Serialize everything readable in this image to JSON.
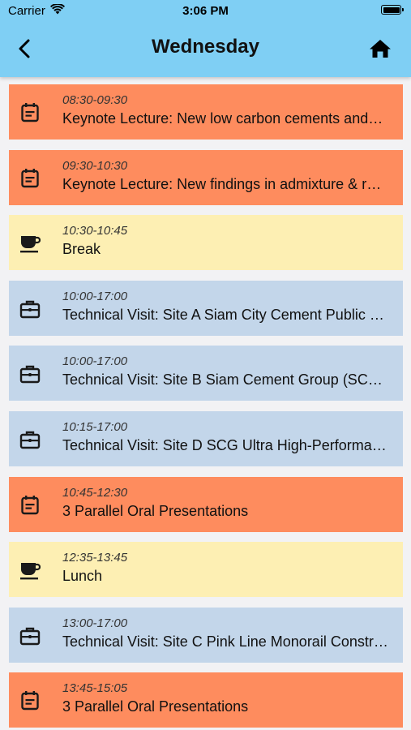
{
  "status_bar": {
    "carrier": "Carrier",
    "time": "3:06 PM",
    "wifi_icon": "wifi-icon",
    "battery_icon": "battery-icon"
  },
  "nav": {
    "title": "Wednesday",
    "back_icon": "chevron-left-icon",
    "home_icon": "home-icon",
    "color": "#7fcff4"
  },
  "colors": {
    "lecture": "#fe8c5e",
    "break": "#fdefb3",
    "visit": "#c3d6ea"
  },
  "schedule": [
    {
      "type": "lecture",
      "icon": "calendar-icon",
      "time": "08:30-09:30",
      "title": "Keynote Lecture: New low carbon cements and…"
    },
    {
      "type": "lecture",
      "icon": "calendar-icon",
      "time": "09:30-10:30",
      "title": "Keynote Lecture: New findings in admixture & r…"
    },
    {
      "type": "break",
      "icon": "coffee-icon",
      "time": "10:30-10:45",
      "title": "Break"
    },
    {
      "type": "visit",
      "icon": "briefcase-icon",
      "time": "10:00-17:00",
      "title": "Technical Visit: Site A Siam City Cement Public …"
    },
    {
      "type": "visit",
      "icon": "briefcase-icon",
      "time": "10:00-17:00",
      "title": "Technical Visit: Site B Siam Cement Group (SCG…"
    },
    {
      "type": "visit",
      "icon": "briefcase-icon",
      "time": "10:15-17:00",
      "title": "Technical Visit: Site D SCG Ultra High-Performa…"
    },
    {
      "type": "lecture",
      "icon": "calendar-icon",
      "time": "10:45-12:30",
      "title": "3 Parallel Oral Presentations"
    },
    {
      "type": "break",
      "icon": "coffee-icon",
      "time": "12:35-13:45",
      "title": "Lunch"
    },
    {
      "type": "visit",
      "icon": "briefcase-icon",
      "time": "13:00-17:00",
      "title": "Technical Visit: Site C Pink Line Monorail Constr…"
    },
    {
      "type": "lecture",
      "icon": "calendar-icon",
      "time": "13:45-15:05",
      "title": "3 Parallel Oral Presentations"
    }
  ]
}
